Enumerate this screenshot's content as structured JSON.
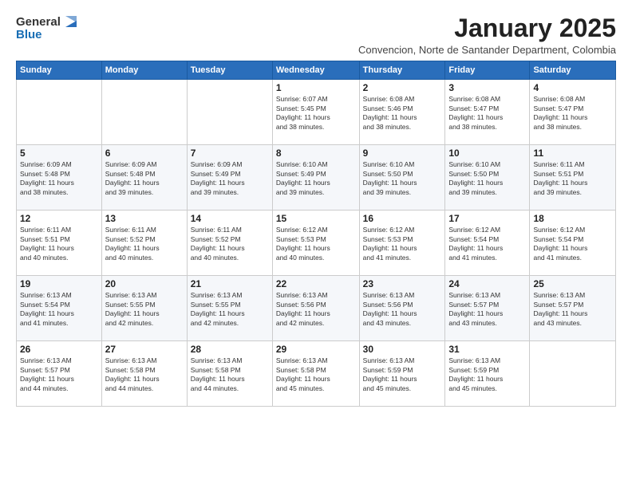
{
  "logo": {
    "general": "General",
    "blue": "Blue"
  },
  "title": "January 2025",
  "subtitle": "Convencion, Norte de Santander Department, Colombia",
  "days_of_week": [
    "Sunday",
    "Monday",
    "Tuesday",
    "Wednesday",
    "Thursday",
    "Friday",
    "Saturday"
  ],
  "weeks": [
    [
      {
        "day": "",
        "info": ""
      },
      {
        "day": "",
        "info": ""
      },
      {
        "day": "",
        "info": ""
      },
      {
        "day": "1",
        "info": "Sunrise: 6:07 AM\nSunset: 5:45 PM\nDaylight: 11 hours\nand 38 minutes."
      },
      {
        "day": "2",
        "info": "Sunrise: 6:08 AM\nSunset: 5:46 PM\nDaylight: 11 hours\nand 38 minutes."
      },
      {
        "day": "3",
        "info": "Sunrise: 6:08 AM\nSunset: 5:47 PM\nDaylight: 11 hours\nand 38 minutes."
      },
      {
        "day": "4",
        "info": "Sunrise: 6:08 AM\nSunset: 5:47 PM\nDaylight: 11 hours\nand 38 minutes."
      }
    ],
    [
      {
        "day": "5",
        "info": "Sunrise: 6:09 AM\nSunset: 5:48 PM\nDaylight: 11 hours\nand 38 minutes."
      },
      {
        "day": "6",
        "info": "Sunrise: 6:09 AM\nSunset: 5:48 PM\nDaylight: 11 hours\nand 39 minutes."
      },
      {
        "day": "7",
        "info": "Sunrise: 6:09 AM\nSunset: 5:49 PM\nDaylight: 11 hours\nand 39 minutes."
      },
      {
        "day": "8",
        "info": "Sunrise: 6:10 AM\nSunset: 5:49 PM\nDaylight: 11 hours\nand 39 minutes."
      },
      {
        "day": "9",
        "info": "Sunrise: 6:10 AM\nSunset: 5:50 PM\nDaylight: 11 hours\nand 39 minutes."
      },
      {
        "day": "10",
        "info": "Sunrise: 6:10 AM\nSunset: 5:50 PM\nDaylight: 11 hours\nand 39 minutes."
      },
      {
        "day": "11",
        "info": "Sunrise: 6:11 AM\nSunset: 5:51 PM\nDaylight: 11 hours\nand 39 minutes."
      }
    ],
    [
      {
        "day": "12",
        "info": "Sunrise: 6:11 AM\nSunset: 5:51 PM\nDaylight: 11 hours\nand 40 minutes."
      },
      {
        "day": "13",
        "info": "Sunrise: 6:11 AM\nSunset: 5:52 PM\nDaylight: 11 hours\nand 40 minutes."
      },
      {
        "day": "14",
        "info": "Sunrise: 6:11 AM\nSunset: 5:52 PM\nDaylight: 11 hours\nand 40 minutes."
      },
      {
        "day": "15",
        "info": "Sunrise: 6:12 AM\nSunset: 5:53 PM\nDaylight: 11 hours\nand 40 minutes."
      },
      {
        "day": "16",
        "info": "Sunrise: 6:12 AM\nSunset: 5:53 PM\nDaylight: 11 hours\nand 41 minutes."
      },
      {
        "day": "17",
        "info": "Sunrise: 6:12 AM\nSunset: 5:54 PM\nDaylight: 11 hours\nand 41 minutes."
      },
      {
        "day": "18",
        "info": "Sunrise: 6:12 AM\nSunset: 5:54 PM\nDaylight: 11 hours\nand 41 minutes."
      }
    ],
    [
      {
        "day": "19",
        "info": "Sunrise: 6:13 AM\nSunset: 5:54 PM\nDaylight: 11 hours\nand 41 minutes."
      },
      {
        "day": "20",
        "info": "Sunrise: 6:13 AM\nSunset: 5:55 PM\nDaylight: 11 hours\nand 42 minutes."
      },
      {
        "day": "21",
        "info": "Sunrise: 6:13 AM\nSunset: 5:55 PM\nDaylight: 11 hours\nand 42 minutes."
      },
      {
        "day": "22",
        "info": "Sunrise: 6:13 AM\nSunset: 5:56 PM\nDaylight: 11 hours\nand 42 minutes."
      },
      {
        "day": "23",
        "info": "Sunrise: 6:13 AM\nSunset: 5:56 PM\nDaylight: 11 hours\nand 43 minutes."
      },
      {
        "day": "24",
        "info": "Sunrise: 6:13 AM\nSunset: 5:57 PM\nDaylight: 11 hours\nand 43 minutes."
      },
      {
        "day": "25",
        "info": "Sunrise: 6:13 AM\nSunset: 5:57 PM\nDaylight: 11 hours\nand 43 minutes."
      }
    ],
    [
      {
        "day": "26",
        "info": "Sunrise: 6:13 AM\nSunset: 5:57 PM\nDaylight: 11 hours\nand 44 minutes."
      },
      {
        "day": "27",
        "info": "Sunrise: 6:13 AM\nSunset: 5:58 PM\nDaylight: 11 hours\nand 44 minutes."
      },
      {
        "day": "28",
        "info": "Sunrise: 6:13 AM\nSunset: 5:58 PM\nDaylight: 11 hours\nand 44 minutes."
      },
      {
        "day": "29",
        "info": "Sunrise: 6:13 AM\nSunset: 5:58 PM\nDaylight: 11 hours\nand 45 minutes."
      },
      {
        "day": "30",
        "info": "Sunrise: 6:13 AM\nSunset: 5:59 PM\nDaylight: 11 hours\nand 45 minutes."
      },
      {
        "day": "31",
        "info": "Sunrise: 6:13 AM\nSunset: 5:59 PM\nDaylight: 11 hours\nand 45 minutes."
      },
      {
        "day": "",
        "info": ""
      }
    ]
  ]
}
